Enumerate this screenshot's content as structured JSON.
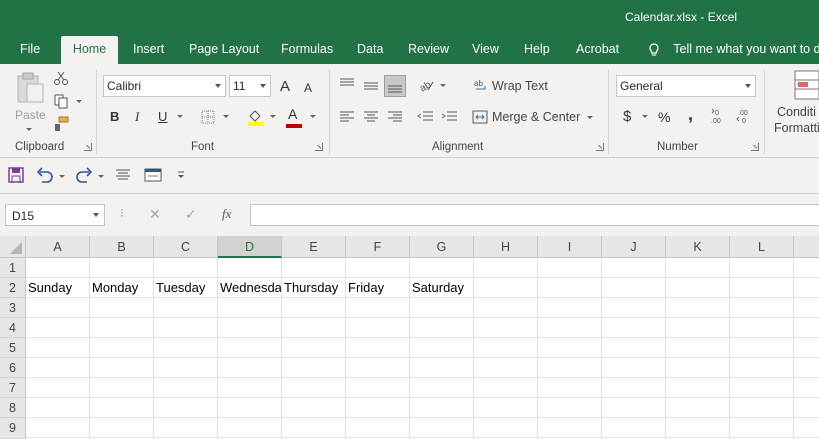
{
  "window": {
    "title": "Calendar.xlsx  -  Excel"
  },
  "tabs": [
    {
      "label": "File"
    },
    {
      "label": "Home"
    },
    {
      "label": "Insert"
    },
    {
      "label": "Page Layout"
    },
    {
      "label": "Formulas"
    },
    {
      "label": "Data"
    },
    {
      "label": "Review"
    },
    {
      "label": "View"
    },
    {
      "label": "Help"
    },
    {
      "label": "Acrobat"
    }
  ],
  "active_tab": "Home",
  "tell_me": "Tell me what you want to do",
  "clipboard": {
    "paste_label": "Paste",
    "group_label": "Clipboard"
  },
  "font": {
    "name": "Calibri",
    "size": "11",
    "group_label": "Font",
    "bold": "B",
    "italic": "I",
    "underline": "U",
    "grow": "A",
    "shrink": "A",
    "font_color": "A"
  },
  "alignment": {
    "wrap_text": "Wrap Text",
    "merge_center": "Merge & Center",
    "group_label": "Alignment"
  },
  "number": {
    "format": "General",
    "currency": "$",
    "percent": "%",
    "comma": ",",
    "group_label": "Number"
  },
  "styles": {
    "conditional_formatting_1": "Conditi",
    "conditional_formatting_2": "Formatti"
  },
  "formula_bar": {
    "name_box": "D15",
    "cancel": "✕",
    "enter": "✓",
    "fx": "fx",
    "value": ""
  },
  "colors": {
    "accent": "#217346",
    "fill_highlight": "#ffff00",
    "font_red": "#c00000"
  },
  "columns": [
    "A",
    "B",
    "C",
    "D",
    "E",
    "F",
    "G",
    "H",
    "I",
    "J",
    "K",
    "L"
  ],
  "selected_column": "D",
  "rows": [
    "1",
    "2",
    "3",
    "4",
    "5",
    "6",
    "7",
    "8",
    "9"
  ],
  "cells": {
    "row2": [
      "Sunday",
      "Monday",
      "Tuesday",
      "Wednesday",
      "Thursday",
      "Friday",
      "Saturday"
    ]
  }
}
